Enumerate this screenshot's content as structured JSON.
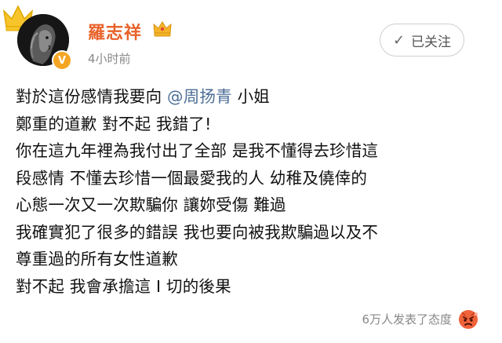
{
  "post": {
    "user": {
      "name": "羅志祥",
      "verified_badge": "V",
      "timestamp": "4小时前"
    },
    "follow_button": {
      "icon": "check-icon",
      "label": "已关注"
    },
    "content": {
      "line1_before": "對於這份感情我要向",
      "mention": "@周扬青",
      "line1_after": "小姐",
      "line2": "鄭重的道歉 對不起 我錯了!",
      "line3": "你在這九年裡為我付出了全部 是我不懂得去珍惜這",
      "line4": "段感情 不懂去珍惜一個最愛我的人 幼稚及僥倖的",
      "line5": "心態一次又一次欺騙你 讓妳受傷 難過",
      "line6": "我確實犯了很多的錯誤 我也要向被我欺騙過以及不",
      "line7": "尊重過的所有女性道歉",
      "line8": "對不起  我會承擔這 I 切的後果"
    },
    "reactions": {
      "summary": "6万人发表了态度",
      "icon": "angry-face-icon"
    },
    "colors": {
      "username": "#e8622a",
      "mention": "#4c6e96",
      "verified": "#f4a623",
      "muted": "#888888"
    }
  }
}
